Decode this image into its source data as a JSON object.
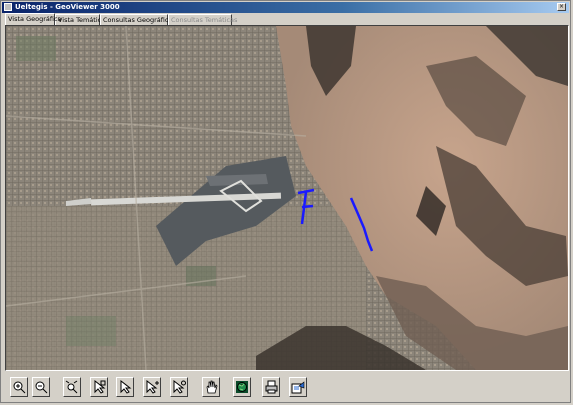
{
  "window": {
    "title": "Ueltegis - GeoViewer 3000",
    "controls": {
      "close": "×"
    }
  },
  "tabs": [
    {
      "label": "Vista Geográfica",
      "state": "active"
    },
    {
      "label": "Vista Temática",
      "state": "normal"
    },
    {
      "label": "Consultas Geográficas",
      "state": "normal"
    },
    {
      "label": "Consultas Temáticas",
      "state": "disabled"
    }
  ],
  "map": {
    "description_icon": "satellite-map",
    "overlay_color": "#1a1aff"
  },
  "toolbar": {
    "buttons": [
      {
        "name": "zoom-in-button",
        "icon": "magnifier-plus-icon"
      },
      {
        "name": "zoom-out-button",
        "icon": "magnifier-minus-icon"
      },
      {
        "name": "zoom-extent-button",
        "icon": "magnifier-arrows-icon"
      },
      {
        "name": "select-pointer-button",
        "icon": "pointer-select-icon"
      },
      {
        "name": "pointer-button",
        "icon": "arrow-pointer-icon"
      },
      {
        "name": "select-add-button",
        "icon": "pointer-plus-icon"
      },
      {
        "name": "select-info-button",
        "icon": "pointer-info-icon"
      },
      {
        "name": "pan-button",
        "icon": "hand-icon"
      },
      {
        "name": "globe-button",
        "icon": "globe-icon"
      },
      {
        "name": "print-button",
        "icon": "printer-icon"
      },
      {
        "name": "export-button",
        "icon": "export-map-icon"
      }
    ]
  }
}
